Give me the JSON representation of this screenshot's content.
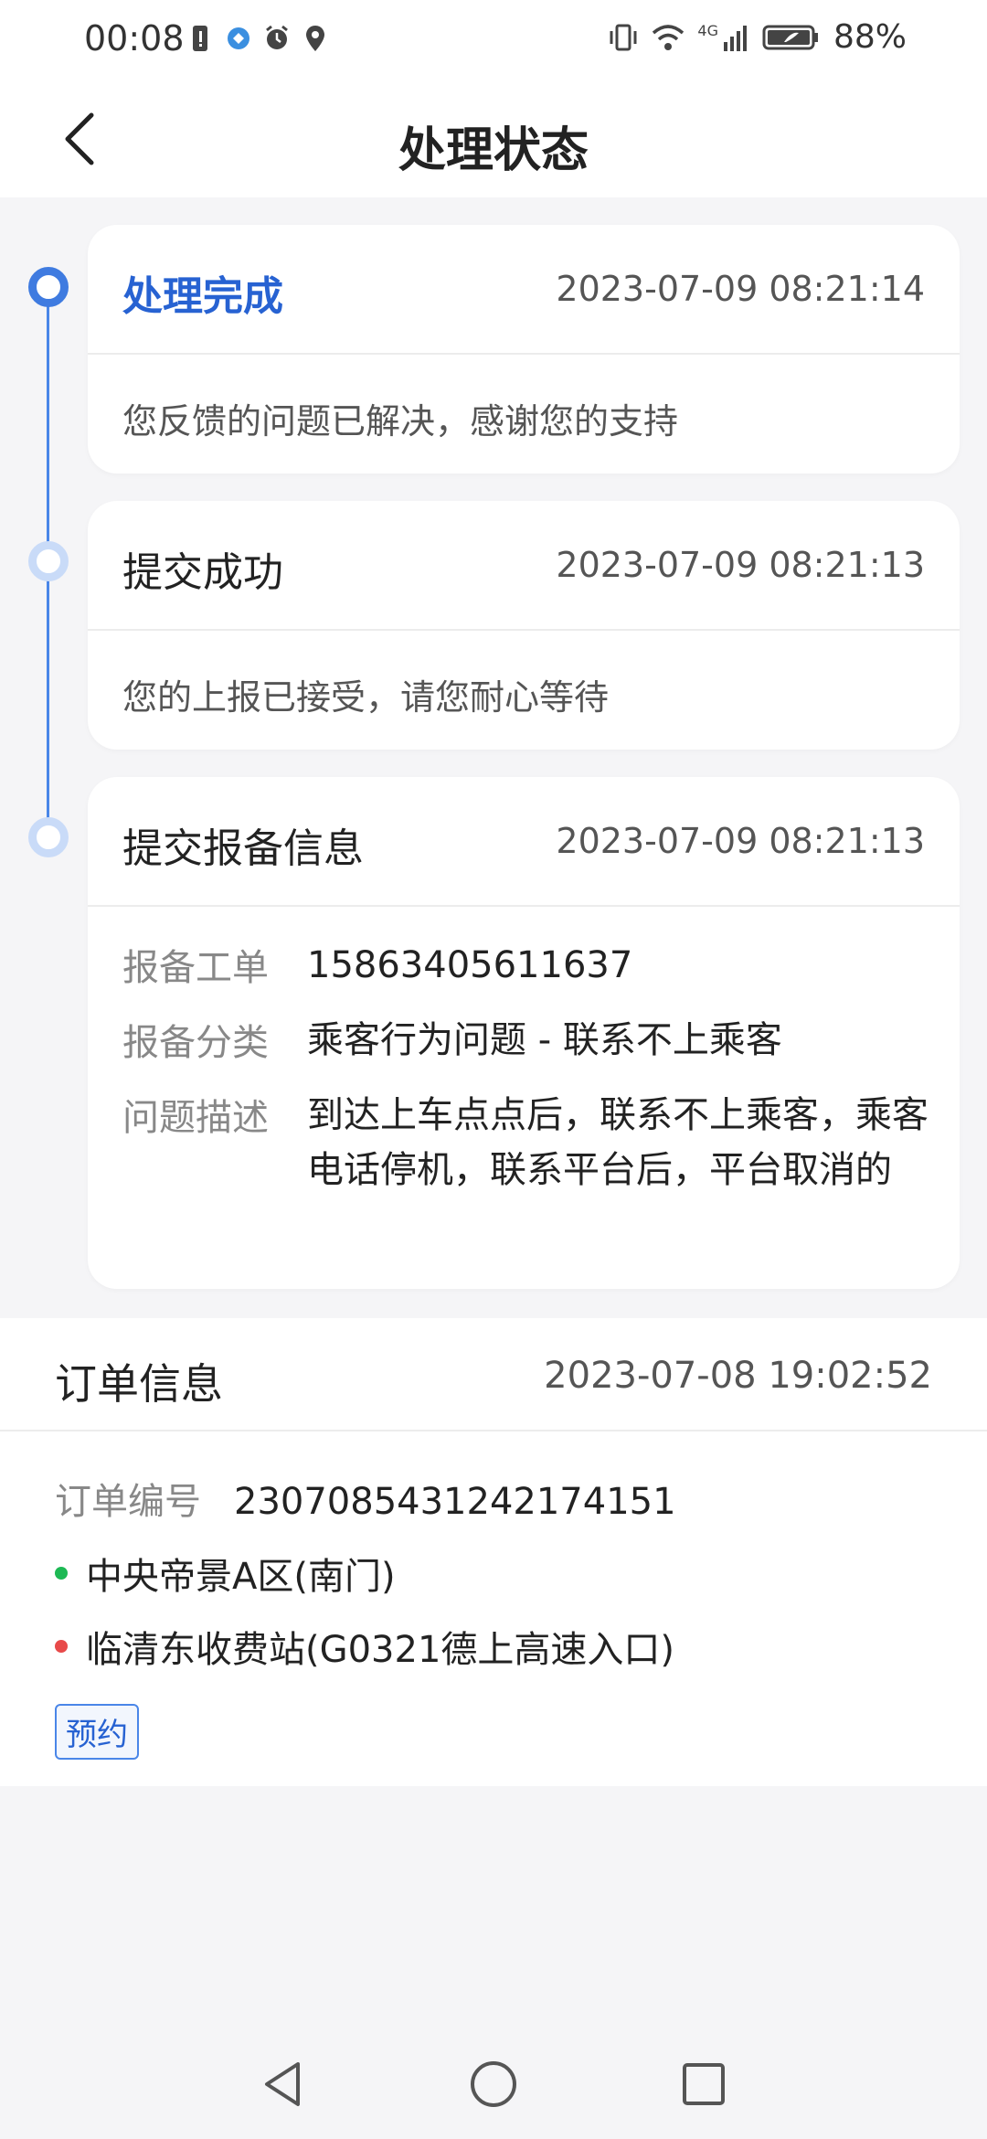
{
  "status_bar": {
    "time": "00:08",
    "network": "4G",
    "battery": "88%"
  },
  "header": {
    "title": "处理状态",
    "back_icon": "chevron-left-icon"
  },
  "timeline": [
    {
      "title": "处理完成",
      "time": "2023-07-09 08:21:14",
      "message": "您反馈的问题已解决，感谢您的支持",
      "state": "active"
    },
    {
      "title": "提交成功",
      "time": "2023-07-09 08:21:13",
      "message": "您的上报已接受，请您耐心等待",
      "state": "pending"
    },
    {
      "title": "提交报备信息",
      "time": "2023-07-09 08:21:13",
      "details": [
        {
          "label": "报备工单",
          "value": "15863405611637"
        },
        {
          "label": "报备分类",
          "value": "乘客行为问题 - 联系不上乘客"
        },
        {
          "label": "问题描述",
          "value": "到达上车点点后，联系不上乘客，乘客电话停机，联系平台后，平台取消的"
        }
      ],
      "state": "pending"
    }
  ],
  "order": {
    "title": "订单信息",
    "time": "2023-07-08 19:02:52",
    "id_label": "订单编号",
    "id_value": "2307085431242174151",
    "start": "中央帝景A区(南门)",
    "end": "临清东收费站(G0321德上高速入口)",
    "tag": "预约"
  },
  "colors": {
    "accent": "#2762d2",
    "timeline": "#4a86e8",
    "start_dot": "#1db954",
    "end_dot": "#e84a4a"
  }
}
